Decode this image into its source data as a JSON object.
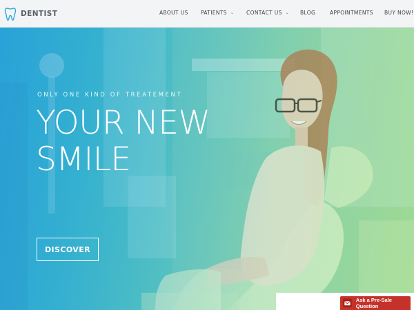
{
  "brand": {
    "name": "DENTIST",
    "logo_icon": "tooth-icon"
  },
  "nav": {
    "items": [
      {
        "label": "ABOUT US",
        "has_dropdown": false
      },
      {
        "label": "PATIENTS",
        "has_dropdown": true
      },
      {
        "label": "CONTACT US",
        "has_dropdown": true
      },
      {
        "label": "BLOG",
        "has_dropdown": false
      },
      {
        "label": "APPOINTMENTS",
        "has_dropdown": false
      },
      {
        "label": "BUY NOW!",
        "has_dropdown": false
      }
    ],
    "caret_glyph": "⌄"
  },
  "hero": {
    "tagline": "ONLY ONE KIND OF TREATEMENT",
    "headline_line1": "YOUR NEW",
    "headline_line2": "SMILE",
    "cta_label": "DISCOVER"
  },
  "presale": {
    "label": "Ask a Pre-Sale Question",
    "icon": "envelope-icon",
    "color": "#c5322a"
  },
  "colors": {
    "gradient_left": "#2fa9d9",
    "gradient_right": "#a8dd88",
    "header_bg": "#f3f4f5"
  }
}
